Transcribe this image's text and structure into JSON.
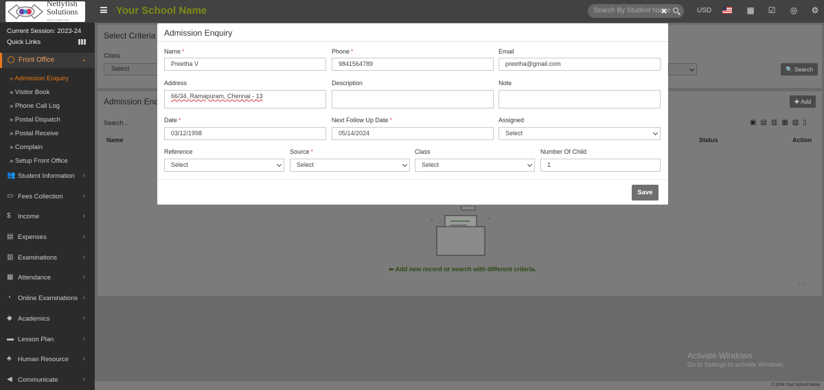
{
  "brand": {
    "logo_line1": "Nettyfish",
    "logo_line2": "Solutions",
    "logo_tagline": "ignite your business online",
    "school_name": "Your School Name"
  },
  "topbar": {
    "search_placeholder": "Search By Student Name",
    "currency": "USD",
    "icons": [
      "calendar-icon",
      "check-square-icon",
      "whatsapp-icon",
      "gear-icon"
    ]
  },
  "sidebar": {
    "session": "Current Session: 2023-24",
    "quick_links": "Quick Links",
    "active_section": "Front Office",
    "submenu": [
      {
        "label": "» Admission Enquiry",
        "active": true
      },
      {
        "label": "» Visitor Book",
        "active": false
      },
      {
        "label": "» Phone Call Log",
        "active": false
      },
      {
        "label": "» Postal Dispatch",
        "active": false
      },
      {
        "label": "» Postal Receive",
        "active": false
      },
      {
        "label": "» Complain",
        "active": false
      },
      {
        "label": "» Setup Front Office",
        "active": false
      }
    ],
    "menu": [
      {
        "label": "Student Information",
        "icon": "user-icon",
        "glyph": "👥"
      },
      {
        "label": "Fees Collection",
        "icon": "money-icon",
        "glyph": "▭"
      },
      {
        "label": "Income",
        "icon": "dollar-icon",
        "glyph": "$"
      },
      {
        "label": "Expenses",
        "icon": "credit-card-icon",
        "glyph": "▤"
      },
      {
        "label": "Examinations",
        "icon": "map-icon",
        "glyph": "▥"
      },
      {
        "label": "Attendance",
        "icon": "calendar-check-icon",
        "glyph": "▦"
      },
      {
        "label": "Online Examinations",
        "icon": "rss-icon",
        "glyph": "◔"
      },
      {
        "label": "Academics",
        "icon": "graduation-cap-icon",
        "glyph": "◆"
      },
      {
        "label": "Lesson Plan",
        "icon": "list-icon",
        "glyph": "▬"
      },
      {
        "label": "Human Resource",
        "icon": "sitemap-icon",
        "glyph": "♣"
      },
      {
        "label": "Communicate",
        "icon": "bullhorn-icon",
        "glyph": "◀"
      }
    ]
  },
  "background": {
    "criteria_title": "Select Criteria",
    "class_label": "Class",
    "class_select": "Select",
    "search_button": "Search",
    "list_title": "Admission Enquiry",
    "add_button": "Add",
    "list_search": "Search...",
    "col_name": "Name",
    "col_status": "Status",
    "col_action": "Action",
    "empty_message": "Add new record or search with different criteria.",
    "activate_title": "Activate Windows",
    "activate_sub": "Go to Settings to activate Windows.",
    "footer": "© 2024 Your School Name"
  },
  "modal": {
    "title": "Admission Enquiry",
    "close": "×",
    "fields": {
      "name": {
        "label": "Name",
        "value": "Preetha V",
        "required": true
      },
      "phone": {
        "label": "Phone",
        "value": "9841564789",
        "required": true
      },
      "email": {
        "label": "Email",
        "value": "preetha@gmail.com",
        "required": false
      },
      "address": {
        "label": "Address",
        "value": "66/34, Ramapuram, Chennai - 13"
      },
      "description": {
        "label": "Description",
        "value": ""
      },
      "note": {
        "label": "Note",
        "value": ""
      },
      "date": {
        "label": "Date",
        "value": "03/12/1998",
        "required": true
      },
      "next_follow_up": {
        "label": "Next Follow Up Date",
        "value": "05/14/2024",
        "required": true
      },
      "assigned": {
        "label": "Assigned",
        "value": "Select"
      },
      "reference": {
        "label": "Reference",
        "value": "Select"
      },
      "source": {
        "label": "Source",
        "value": "Select",
        "required": true
      },
      "class": {
        "label": "Class",
        "value": "Select"
      },
      "number_of_child": {
        "label": "Number Of Child",
        "value": "1"
      }
    },
    "save_label": "Save"
  }
}
